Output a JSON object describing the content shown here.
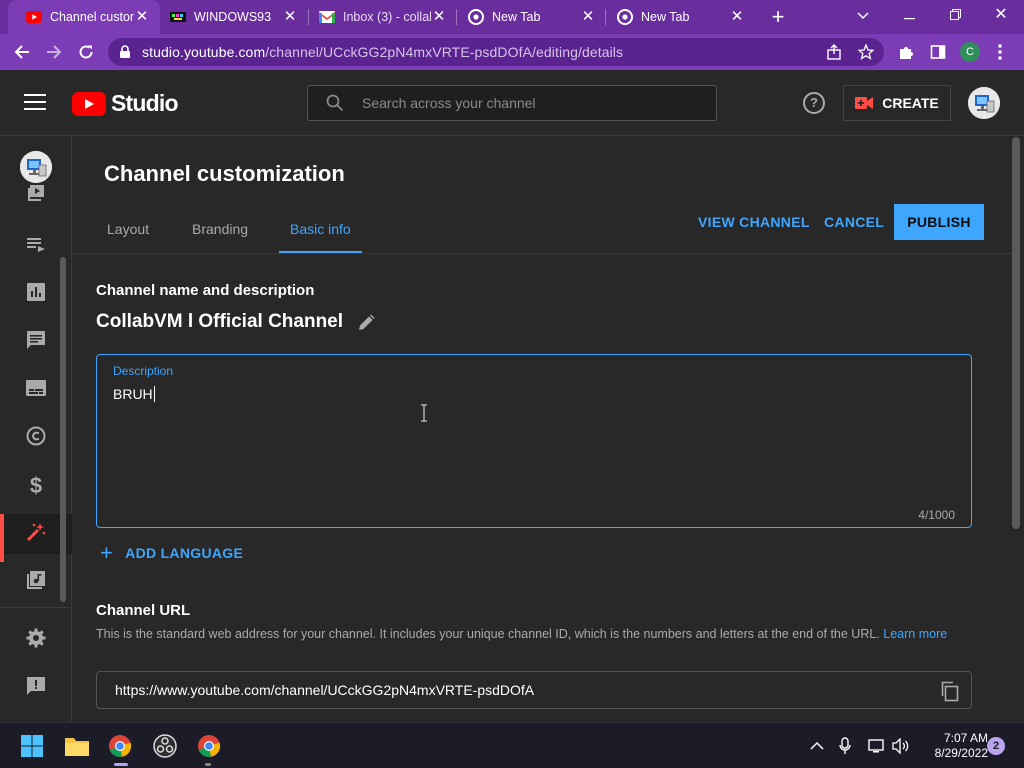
{
  "browser": {
    "tabs": [
      {
        "title": "Channel customiz",
        "icon": "youtube-studio-favicon",
        "active": true
      },
      {
        "title": "WINDOWS93",
        "icon": "windows93-favicon",
        "active": false
      },
      {
        "title": "Inbox (3) - collab",
        "icon": "gmail-favicon",
        "active": false
      },
      {
        "title": "New Tab",
        "icon": "chrome-favicon",
        "active": false
      },
      {
        "title": "New Tab",
        "icon": "chrome-favicon",
        "active": false
      }
    ],
    "url_host": "studio.youtube.com",
    "url_path": "/channel/UCckGG2pN4mxVRTE-psdDOfA/editing/details",
    "profile_initial": "C",
    "colors": {
      "frame": "#6a2d9e",
      "toolbar": "#7b3cb5",
      "omnibox": "#5a2390"
    }
  },
  "studio": {
    "logo_text": "Studio",
    "search_placeholder": "Search across your channel",
    "create_label": "CREATE",
    "colors": {
      "accent": "#3ea6ff",
      "brand_red": "#ff0000",
      "active_nav": "#ff4e45",
      "background": "#282828"
    }
  },
  "nav": {
    "items": [
      {
        "name": "content",
        "icon": "content-icon"
      },
      {
        "name": "playlists",
        "icon": "playlists-icon"
      },
      {
        "name": "analytics",
        "icon": "analytics-icon"
      },
      {
        "name": "comments",
        "icon": "comments-icon"
      },
      {
        "name": "subtitles",
        "icon": "subtitles-icon"
      },
      {
        "name": "copyright",
        "icon": "copyright-icon"
      },
      {
        "name": "earn",
        "icon": "dollar-icon"
      },
      {
        "name": "customization",
        "icon": "magic-wand-icon",
        "active": true
      },
      {
        "name": "audio-library",
        "icon": "audio-library-icon"
      },
      {
        "name": "settings",
        "icon": "gear-icon"
      },
      {
        "name": "send-feedback",
        "icon": "feedback-icon"
      }
    ]
  },
  "page": {
    "title": "Channel customization",
    "tabs": [
      {
        "label": "Layout",
        "active": false
      },
      {
        "label": "Branding",
        "active": false
      },
      {
        "label": "Basic info",
        "active": true
      }
    ],
    "actions": {
      "view_channel": "VIEW CHANNEL",
      "cancel": "CANCEL",
      "publish": "PUBLISH"
    }
  },
  "basic_info": {
    "name_section_title": "Channel name and description",
    "channel_name": "CollabVM l Official Channel",
    "description": {
      "label": "Description",
      "value": "BRUH",
      "count": "4/1000"
    },
    "add_language": "ADD LANGUAGE",
    "url_section_title": "Channel URL",
    "url_help": "This is the standard web address for your channel. It includes your unique channel ID, which is the numbers and letters at the end of the URL.",
    "url_help_link": "Learn more",
    "channel_url": "https://www.youtube.com/channel/UCckGG2pN4mxVRTE-psdDOfA"
  },
  "taskbar": {
    "apps": [
      "start-icon",
      "file-explorer-icon",
      "chrome-icon",
      "obs-icon",
      "chrome-icon"
    ],
    "time": "7:07 AM",
    "date": "8/29/2022",
    "notifications": "2"
  }
}
